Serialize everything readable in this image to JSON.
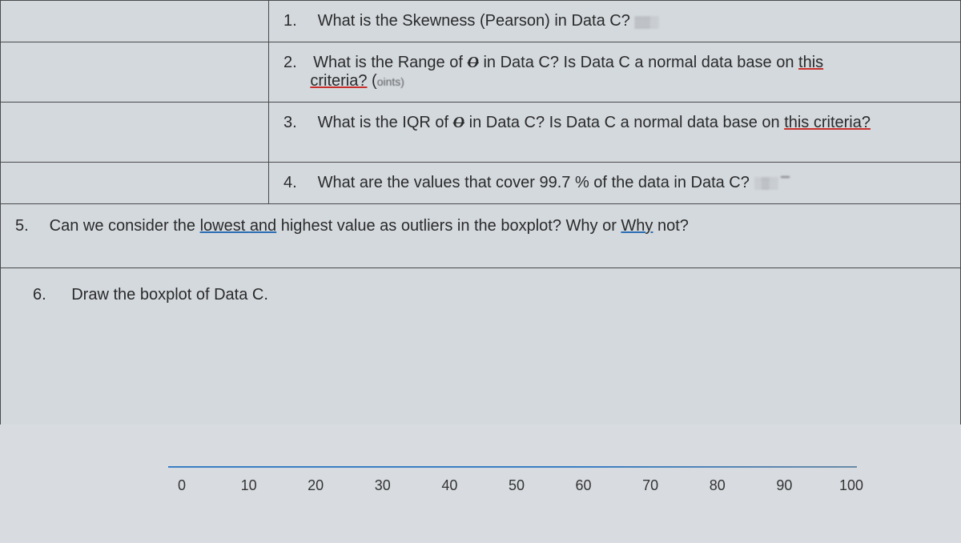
{
  "questions": {
    "q1": {
      "num": "1.",
      "text": "What is the Skewness (Pearson) in Data C?"
    },
    "q2": {
      "num": "2.",
      "text_a": "What is the Range of ",
      "sigma": "O",
      "text_b": " in Data C? Is Data C a normal data base on ",
      "underlined": "this",
      "line2_a": "criteria?",
      "line2_b": " (",
      "line2_blur": "oints)",
      "line2_c": ""
    },
    "q3": {
      "num": "3.",
      "text_a": "What is the IQR of ",
      "sigma": "O",
      "text_b": " in Data C? Is Data C a normal data base on ",
      "underlined": "this criteria?"
    },
    "q4": {
      "num": "4.",
      "text": "What are the values that cover 99.7 % of the data in Data C?"
    },
    "q5": {
      "num": "5.",
      "text_a": "Can we consider the ",
      "underlined1": "lowest ",
      "underlined1b": "and",
      "text_b": " highest value as outliers in the boxplot?  Why or ",
      "underlined2": "Why",
      "text_c": " not?"
    },
    "q6": {
      "num": "6.",
      "text": "Draw the boxplot of Data C."
    }
  },
  "axis": {
    "ticks": [
      "0",
      "10",
      "20",
      "30",
      "40",
      "50",
      "60",
      "70",
      "80",
      "90",
      "100"
    ]
  }
}
